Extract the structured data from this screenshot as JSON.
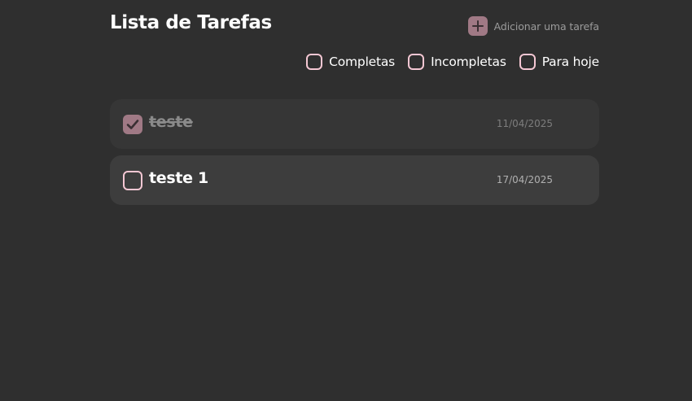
{
  "header": {
    "title": "Lista de Tarefas",
    "add_label": "Adicionar uma tarefa",
    "add_icon": "plus-icon"
  },
  "filters": [
    {
      "label": "Completas",
      "checked": false
    },
    {
      "label": "Incompletas",
      "checked": false
    },
    {
      "label": "Para hoje",
      "checked": false
    }
  ],
  "tasks": [
    {
      "title": "teste",
      "date": "11/04/2025",
      "completed": true
    },
    {
      "title": "teste 1",
      "date": "17/04/2025",
      "completed": false
    }
  ],
  "colors": {
    "background": "#2f2f2f",
    "accent": "#a07985",
    "checkbox_border": "#f4c7d3",
    "card_completed": "#363636",
    "card_pending": "#3d3d3d"
  }
}
